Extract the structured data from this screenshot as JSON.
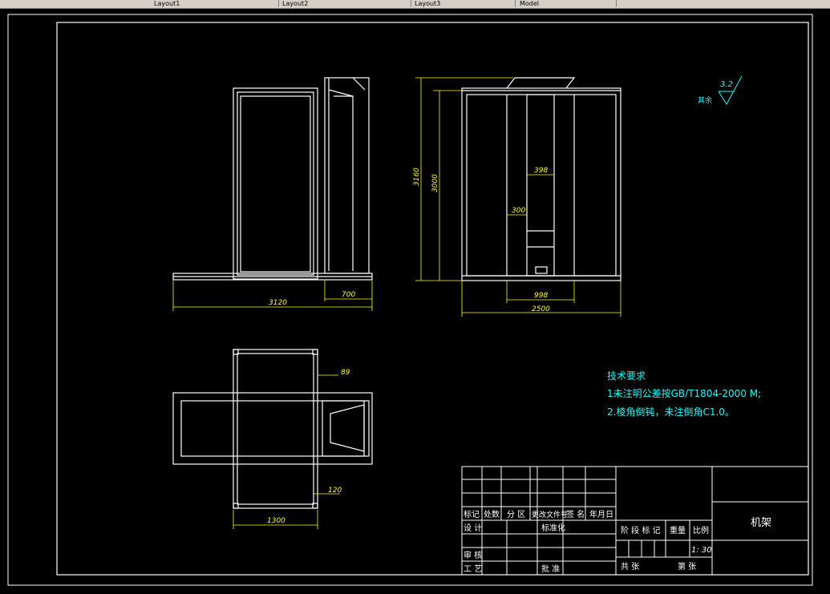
{
  "tabs": [
    {
      "label": "Layout1"
    },
    {
      "label": "Layout2"
    },
    {
      "label": "Layout3"
    },
    {
      "label": "Model"
    }
  ],
  "colors": {
    "line": "#ffffff",
    "dim": "#ffff00",
    "text": "#00ffff",
    "background": "#000000"
  },
  "dimensions": {
    "d3120": "3120",
    "d700": "700",
    "d3160": "3160",
    "d3000": "3000",
    "d398": "398",
    "d300": "300",
    "d998": "998",
    "d2500": "2500",
    "d89": "89",
    "d120": "120",
    "d1300": "1300"
  },
  "roughness": {
    "value": "3.2",
    "label": "其余"
  },
  "notes": {
    "title": "技术要求",
    "line1": "1未注明公差按GB/T1804-2000 M;",
    "line2": "2.棱角倒钝，未注倒角C1.0。"
  },
  "title_block": {
    "col_mark": "标记",
    "col_count": "处数",
    "col_zone": "分 区",
    "col_docno": "更改文件号",
    "col_sign": "签 名",
    "col_date": "年月日",
    "design": "设 计",
    "standard": "标准化",
    "stage": "阶 段 标 记",
    "weight": "重量",
    "scale": "比例",
    "scale_value": "1: 30",
    "review": "审 核",
    "process": "工 艺",
    "approve": "批 准",
    "sheets_total": "共    张",
    "sheet_no": "第    张",
    "part_name": "机架"
  }
}
